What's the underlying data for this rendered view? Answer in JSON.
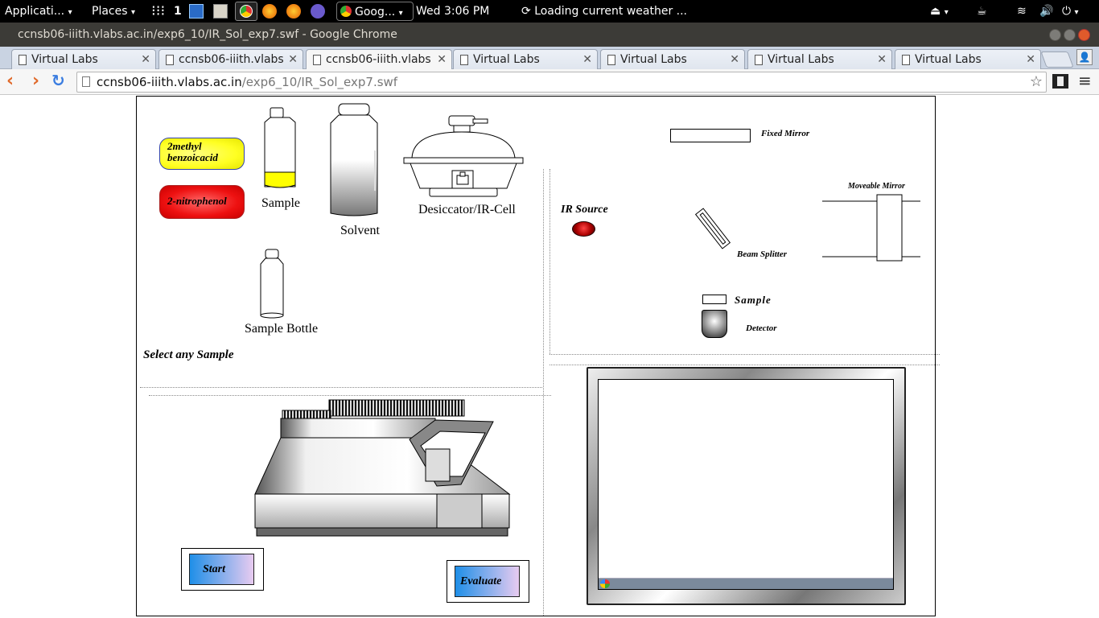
{
  "panel": {
    "applications": "Applicati...",
    "places": "Places",
    "workspace": "1",
    "task_label": "Goog...",
    "clock": "Wed  3:06 PM",
    "weather": "Loading current weather ..."
  },
  "window": {
    "title": "ccnsb06-iiith.vlabs.ac.in/exp6_10/IR_Sol_exp7.swf - Google Chrome"
  },
  "tabs": [
    {
      "label": "Virtual Labs"
    },
    {
      "label": "ccnsb06-iiith.vlabs"
    },
    {
      "label": "ccnsb06-iiith.vlabs"
    },
    {
      "label": "Virtual Labs"
    },
    {
      "label": "Virtual Labs"
    },
    {
      "label": "Virtual Labs"
    },
    {
      "label": "Virtual Labs"
    }
  ],
  "address": {
    "host": "ccnsb06-iiith.vlabs.ac.in",
    "path": "/exp6_10/IR_Sol_exp7.swf"
  },
  "lab": {
    "chemical_1": "2methyl benzoicacid",
    "chemical_2": "2-nitrophenol",
    "sample": "Sample",
    "solvent": "Solvent",
    "desiccator": "Desiccator/IR-Cell",
    "sample_bottle": "Sample Bottle",
    "select_prompt": "Select any Sample",
    "fixed_mirror": "Fixed Mirror",
    "moveable_mirror": "Moveable Mirror",
    "ir_source": "IR Source",
    "beam_splitter": "Beam Splitter",
    "sample_path": "Sample",
    "detector": "Detector",
    "start": "Start",
    "evaluate": "Evaluate"
  },
  "colors": {
    "accent_yellow": "#ffff33",
    "accent_red": "#ee1111",
    "button_blue": "#1f8fe8"
  }
}
